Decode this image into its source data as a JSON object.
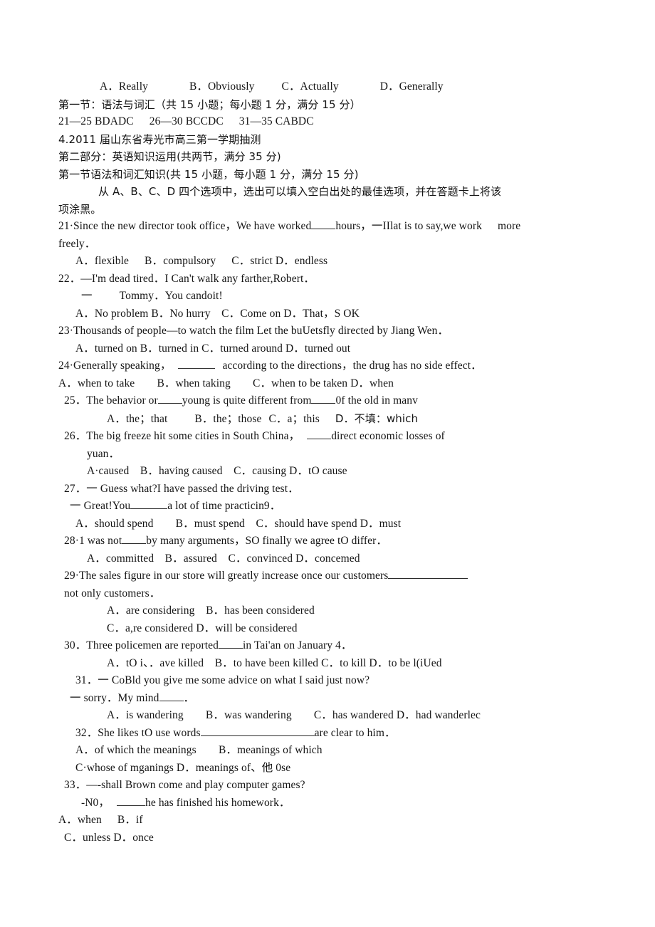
{
  "document": {
    "type": "scanned-exam-paper",
    "language": "zh-CN + en",
    "page_background": "#ffffff",
    "text_color": "#141414"
  },
  "lines": {
    "l01_A": "A．Really",
    "l01_B": "B．Obviously",
    "l01_C": "C．Actually",
    "l01_D": "D．Generally",
    "l02": "第一节：语法与词汇（共 15 小题；每小题 1 分，满分 15 分）",
    "l03_a": "21—25 BDADC",
    "l03_b": "26—30 BCCDC",
    "l03_c": "31—35 CABDC",
    "l04": "4.2011 届山东省寿光市高三第一学期抽测",
    "l05": "第二部分：英语知识运用(共两节，满分 35 分)",
    "l06": "第一节语法和词汇知识(共 15 小题，每小题 1 分，满分 15 分)",
    "l07": "从 A、B、C、D 四个选项中，选出可以填入空白出处的最佳选项，并在答题卡上将该",
    "l08": "项涂黑。",
    "q21_a": "21·Since the new director took office，We have worked",
    "q21_b": "hours，一IIlat is to say,we work",
    "q21_c": "more",
    "q21_d": "freely．",
    "q21_opts_A": "A．flexible",
    "q21_opts_B": "B．compulsory",
    "q21_opts_C": "C．strict D．endless",
    "q22_a": "22．—I'm dead tired．I Can't walk any farther,Robert．",
    "q22_b": "一",
    "q22_c": "Tommy．You candoit!",
    "q22_opts": "A．No problem B．No hurry　C．Come on D．That，S OK",
    "q23_a": "23·Thousands of people—to watch the film Let the buUetsfly directed by Jiang Wen．",
    "q23_opts": "A．turned on B．turned in C．turned around D．turned out",
    "q24_a": "24·Generally speaking，",
    "q24_b": "according to the directions，the drug has no side effect．",
    "q24_opts": "A．when to take　　B．when taking　　C．when to be taken D．when",
    "q25_a": "25．The behavior or",
    "q25_b": "young is quite different from",
    "q25_c": "0f the old in manv",
    "q25_opts_A": "A．the；that",
    "q25_opts_B": "B．the；those",
    "q25_opts_C": "C．a；this",
    "q25_opts_D": "D．不填：which",
    "q26_a": "26．The big freeze hit some cities in South China，",
    "q26_b": "direct economic losses of",
    "q26_c": "yuan．",
    "q26_opts": "A·caused　B．having caused　C．causing D．tO cause",
    "q27_a": "27．一 Guess what?I have passed the driving test．",
    "q27_b": "一 Great!You",
    "q27_c": "a lot of time practicin9．",
    "q27_opts": "A．should spend　　B．must spend　C．should have spend D．must",
    "q28_a": "28·1 was not",
    "q28_b": "by many arguments，SO finally we agree tO differ．",
    "q28_opts": "A．committed　B．assured　C．convinced D．concemed",
    "q29_a": "29·The sales figure in our store will greatly increase once our customers",
    "q29_b": "not only customers．",
    "q29_opts_AB": "A．are considering　B．has been considered",
    "q29_opts_CD": "C．a,re considered D．will be considered",
    "q30_a": "30．Three policemen are reported",
    "q30_b": "in Tai'an on January 4．",
    "q30_opts": "A．tO i、．ave killed　B．to have been killed C．to kill D．to be l(iUed",
    "q31_a": "31．一 CoBld you give me some advice on what I said just now?",
    "q31_b": "一 sorry．My mind",
    "q31_c": "．",
    "q31_opts": "A．is wandering　　B．was wandering　　C．has wandered D．had wanderlec",
    "q32_a": "32．She likes tO use words",
    "q32_b": "are clear to him．",
    "q32_opts_AB": "A．of which the meanings　　B．meanings of which",
    "q32_opts_CD": "C·whose of mganings D．meanings of、他 0se",
    "q33_a": "33．—-shall Brown come and play computer games?",
    "q33_b": "-N0，",
    "q33_c": "he has finished his homework．",
    "q33_opts_AB_A": "A．when",
    "q33_opts_AB_B": "B．if",
    "q33_opts_CD": "C．unless D．once"
  }
}
